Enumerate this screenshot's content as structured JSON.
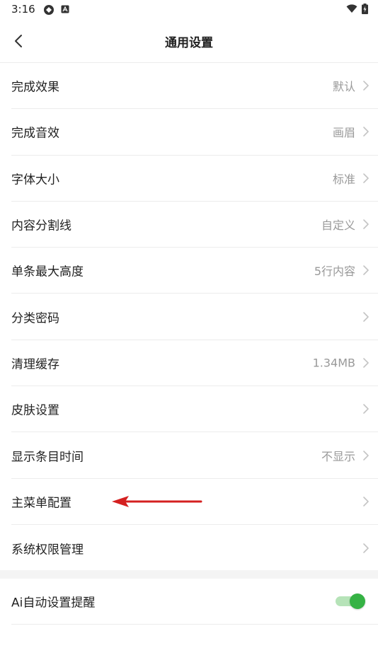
{
  "status_bar": {
    "time": "3:16"
  },
  "header": {
    "title": "通用设置"
  },
  "settings": [
    {
      "label": "完成效果",
      "value": "默认"
    },
    {
      "label": "完成音效",
      "value": "画眉"
    },
    {
      "label": "字体大小",
      "value": "标准"
    },
    {
      "label": "内容分割线",
      "value": "自定义"
    },
    {
      "label": "单条最大高度",
      "value": "5行内容"
    },
    {
      "label": "分类密码",
      "value": ""
    },
    {
      "label": "清理缓存",
      "value": "1.34MB"
    },
    {
      "label": "皮肤设置",
      "value": ""
    },
    {
      "label": "显示条目时间",
      "value": "不显示"
    },
    {
      "label": "主菜单配置",
      "value": ""
    },
    {
      "label": "系统权限管理",
      "value": ""
    }
  ],
  "ai_reminder": {
    "label": "Ai自动设置提醒",
    "enabled": true
  },
  "colors": {
    "accent_green": "#35b244",
    "annotation_red": "#d42020"
  },
  "icons": {
    "back": "chevron-left-icon",
    "row_arrow": "chevron-right-icon",
    "wifi": "wifi-icon",
    "battery": "battery-icon"
  }
}
